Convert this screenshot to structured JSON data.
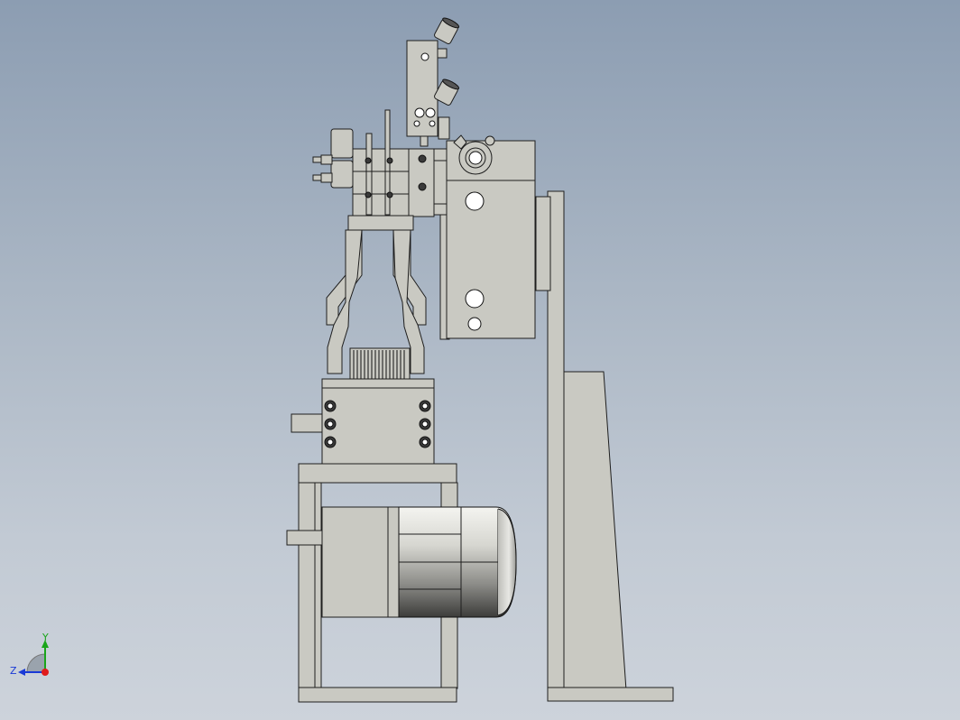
{
  "view": {
    "background_top": "#8c9db2",
    "background_bottom": "#cdd3db",
    "part_color": "#c9c9c2",
    "edge_color": "#1e1e1e"
  },
  "triad": {
    "y_label": "Y",
    "z_label": "Z",
    "y_color": "#1aa51a",
    "z_color": "#1a3ad6",
    "x_color": "#e01b1b"
  }
}
